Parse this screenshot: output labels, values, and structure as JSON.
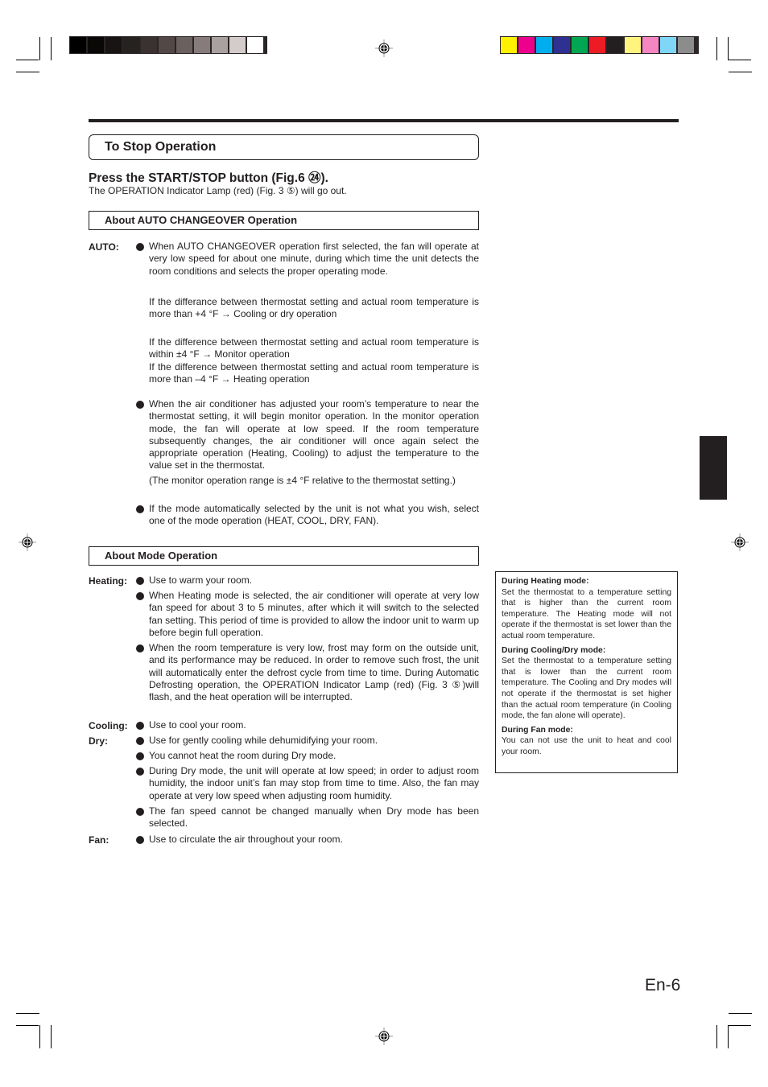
{
  "color_bars": {
    "grayscale": [
      "#000000",
      "#0a0807",
      "#171413",
      "#262220",
      "#3a3130",
      "#524846",
      "#6a605e",
      "#877c7b",
      "#a9a1a0",
      "#d4cccb",
      "#ffffff"
    ],
    "process": [
      "#fff100",
      "#ec008c",
      "#00aeef",
      "#2e3192",
      "#00a651",
      "#ed1c24",
      "#231f20",
      "#fff57e",
      "#f686c1",
      "#7fd6f7",
      "#8c8c8c"
    ]
  },
  "header": {
    "title": "To Stop Operation",
    "instruction": "Press the START/STOP button (Fig.6 ㉔).",
    "instruction_note": "The OPERATION Indicator Lamp (red) (Fig. 3 ⑤) will go out."
  },
  "auto_section": {
    "title": "About AUTO CHANGEOVER Operation",
    "label": "AUTO:",
    "bullet1": "When AUTO CHANGEOVER operation first selected, the fan will operate at very low speed for about one minute, during which time the unit detects the room conditions and selects the proper operating mode.",
    "cond1": "If the differance between thermostat setting and actual room temperature is more than +4 °F → Cooling or dry operation",
    "cond2": "If the difference between thermostat setting and actual room temperature is within ±4 °F → Monitor operation",
    "cond3": "If the difference between thermostat setting and actual room temperature is more than –4 °F → Heating operation",
    "bullet2": "When the air conditioner has adjusted your room’s temperature to near the thermostat setting, it will begin monitor operation. In the monitor operation mode, the fan will operate at low speed. If the room temperature subsequently changes, the air conditioner will once again select the appropriate operation (Heating, Cooling) to adjust the temperature to the value set in the thermostat.",
    "bullet2_note": "(The monitor operation range is ±4 °F relative to the thermostat setting.)",
    "bullet3": "If the mode automatically selected by the unit is not what you wish, select one of the mode operation (HEAT, COOL, DRY, FAN)."
  },
  "mode_section": {
    "title": "About Mode Operation",
    "heating_label": "Heating:",
    "heating": [
      "Use to warm your room.",
      "When Heating mode is selected, the air conditioner will operate at very low fan speed for about 3 to 5 minutes, after which it will switch to the selected fan setting. This period of time is provided to allow the indoor unit to warm up before begin full operation.",
      "When the room temperature is very low, frost may form on the outside unit, and its performance may be reduced. In order to remove such frost, the unit will automatically enter the defrost cycle from time to time. During Automatic Defrosting operation, the OPERATION Indicator Lamp (red)  (Fig. 3 ⑤)will flash, and the heat operation will be interrupted."
    ],
    "cooling_label": "Cooling:",
    "cooling": [
      "Use to cool your room."
    ],
    "dry_label": "Dry:",
    "dry": [
      "Use for gently cooling while dehumidifying your room.",
      "You cannot heat the room during Dry mode.",
      "During Dry mode, the unit will operate at low speed; in order to adjust room humidity, the indoor unit’s fan may stop from time to time. Also, the fan may operate at very low speed when adjusting room humidity.",
      "The fan speed cannot be changed manually when Dry mode has been selected."
    ],
    "fan_label": "Fan:",
    "fan": [
      "Use to circulate the air throughout your room."
    ]
  },
  "sidebar_note": {
    "heating_title": "During Heating mode:",
    "heating_text": "Set the thermostat to a temperature setting that is higher than the current room temperature. The Heating mode will not operate if the thermostat is set lower than the actual room temperature.",
    "cooling_title": "During Cooling/Dry mode:",
    "cooling_text": "Set the thermostat to a temperature setting that is lower than the current room temperature. The Cooling and Dry modes will not operate if the thermostat is set higher than the actual room temperature (in Cooling mode, the fan alone will operate).",
    "fan_title": "During Fan mode:",
    "fan_text": "You can not use the unit to heat and cool your room."
  },
  "footer": {
    "page_number": "En-6"
  }
}
